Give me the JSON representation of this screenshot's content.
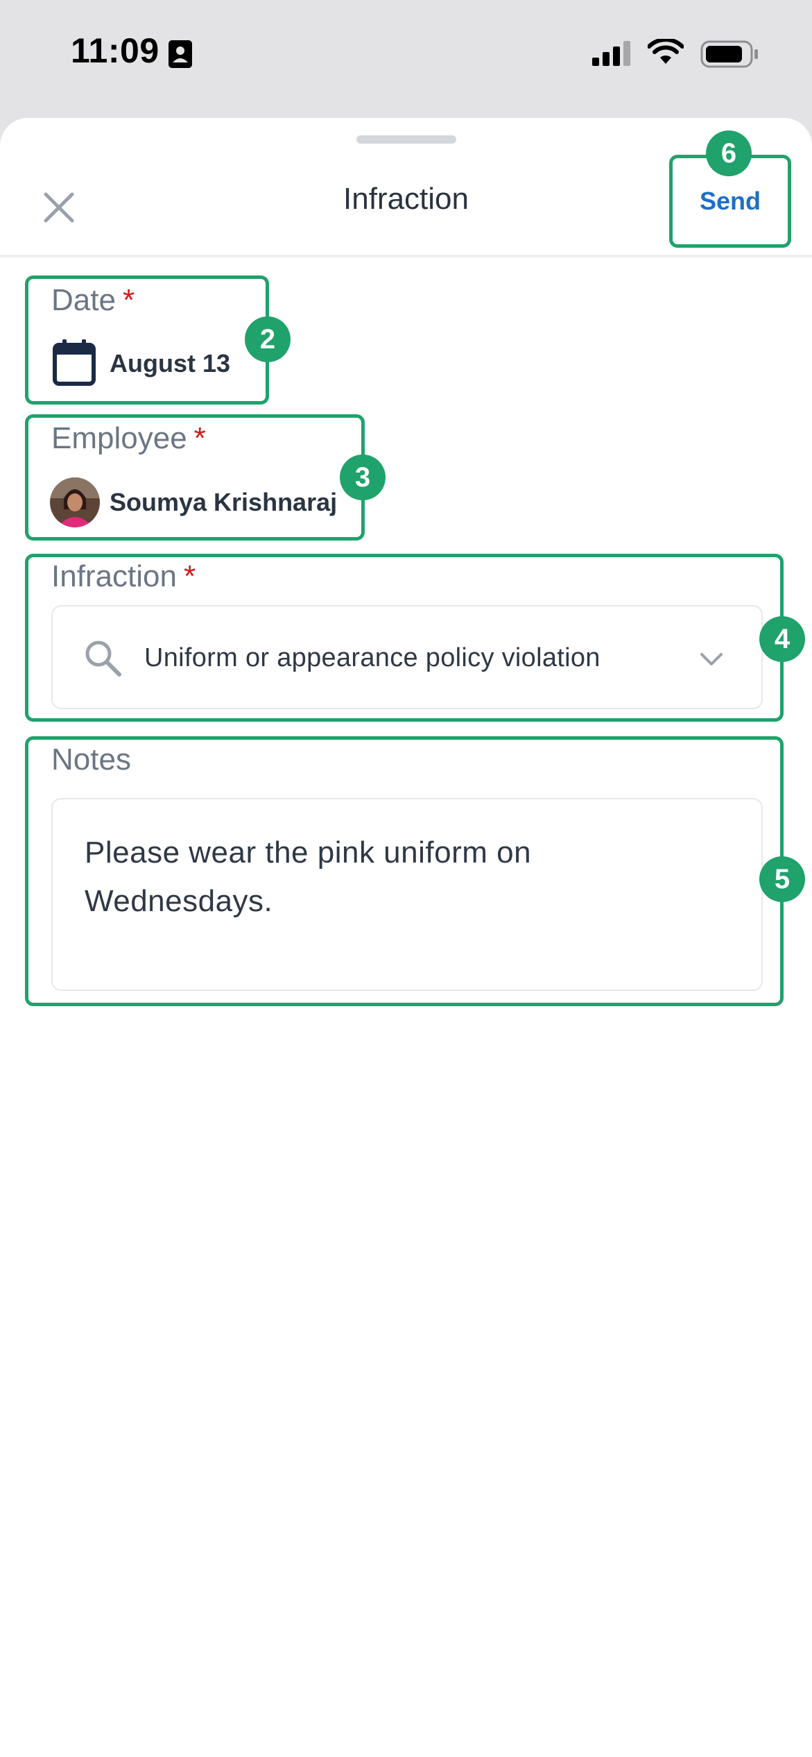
{
  "status_bar": {
    "time": "11:09"
  },
  "sheet": {
    "title": "Infraction",
    "send_label": "Send",
    "send_badge": "6"
  },
  "fields": {
    "date": {
      "label": "Date",
      "required_mark": "*",
      "value": "August 13",
      "badge": "2"
    },
    "employee": {
      "label": "Employee",
      "required_mark": "*",
      "value": "Soumya Krishnaraj",
      "badge": "3"
    },
    "infraction": {
      "label": "Infraction",
      "required_mark": "*",
      "value": "Uniform or appearance policy violation",
      "badge": "4"
    },
    "notes": {
      "label": "Notes",
      "value": "Please wear the pink uniform on\nWednesdays.",
      "badge": "5"
    }
  },
  "icons": {
    "close": "close-icon",
    "calendar": "calendar-icon",
    "search": "search-icon",
    "chevron": "chevron-down-icon"
  },
  "colors": {
    "highlight": "#1fa26b",
    "required": "#d01c1c",
    "send": "#1d6fc7"
  }
}
